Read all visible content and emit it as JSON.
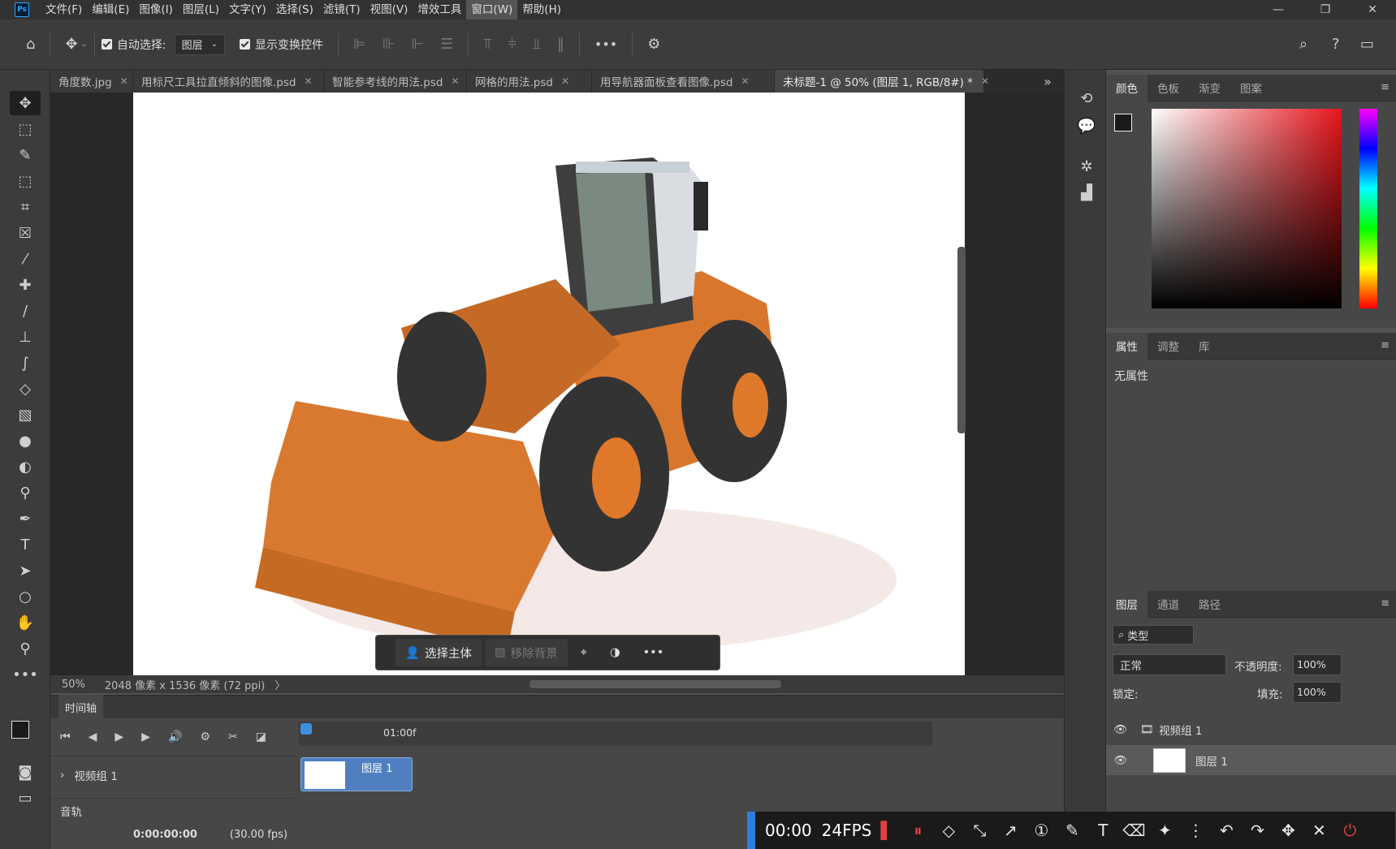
{
  "app": {
    "logo": "Ps"
  },
  "menu": [
    "文件(F)",
    "编辑(E)",
    "图像(I)",
    "图层(L)",
    "文字(Y)",
    "选择(S)",
    "滤镜(T)",
    "视图(V)",
    "增效工具",
    "窗口(W)",
    "帮助(H)"
  ],
  "options": {
    "auto_select_label": "自动选择:",
    "auto_select_value": "图层",
    "show_transform_label": "显示变换控件"
  },
  "tabs": [
    {
      "label": "角度数.jpg"
    },
    {
      "label": "用标尺工具拉直倾斜的图像.psd"
    },
    {
      "label": "智能参考线的用法.psd"
    },
    {
      "label": "网格的用法.psd"
    },
    {
      "label": "用导航器面板查看图像.psd"
    },
    {
      "label": "未标题-1 @ 50% (图层 1, RGB/8#) *"
    }
  ],
  "context_bar": {
    "select_subject": "选择主体",
    "remove_bg": "移除背景",
    "more": "•••"
  },
  "status": {
    "zoom": "50%",
    "doc_info": "2048 像素 x 1536 像素 (72 ppi)",
    "arrow": "〉"
  },
  "timeline": {
    "title": "时间轴",
    "ruler_mark": "01:00f",
    "video_group": "视频组 1",
    "audio_track": "音轨",
    "clip_label": "图层 1",
    "time": "0:00:00:00",
    "fps": "(30.00 fps)"
  },
  "color_panel": {
    "tabs": [
      "颜色",
      "色板",
      "渐变",
      "图案"
    ]
  },
  "props_panel": {
    "tabs": [
      "属性",
      "调整",
      "库"
    ],
    "empty_text": "无属性"
  },
  "layers_panel": {
    "tabs": [
      "图层",
      "通道",
      "路径"
    ],
    "filter_label": "类型",
    "blend_mode": "正常",
    "opacity_label": "不透明度:",
    "opacity_value": "100%",
    "lock_label": "锁定:",
    "fill_label": "填充:",
    "fill_value": "100%",
    "layers": [
      {
        "name": "视频组 1"
      },
      {
        "name": "图层 1"
      }
    ]
  },
  "rec_bar": {
    "timer": "00:00",
    "fps": "24FPS"
  }
}
